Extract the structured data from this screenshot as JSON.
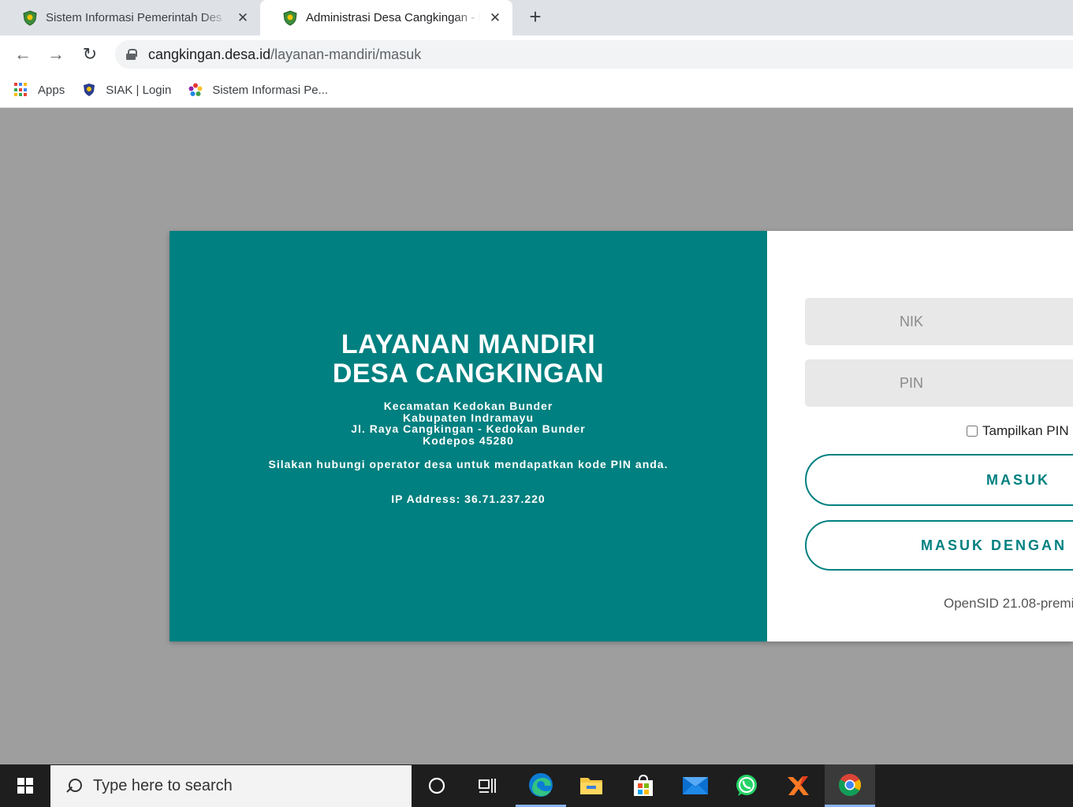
{
  "browser": {
    "tabs": [
      {
        "title": "Sistem Informasi Pemerintah Des",
        "active": false,
        "favicon": "village-emblem-icon"
      },
      {
        "title": "Administrasi Desa Cangkingan - L",
        "active": true,
        "favicon": "village-emblem-icon"
      }
    ],
    "close_glyph": "✕",
    "new_tab_glyph": "+",
    "nav": {
      "back": "←",
      "forward": "→",
      "reload": "↻"
    },
    "url_host": "cangkingan.desa.id",
    "url_path": "/layanan-mandiri/masuk",
    "bookmarks": [
      {
        "label": "Apps",
        "icon": "apps-grid-icon"
      },
      {
        "label": "SIAK | Login",
        "icon": "emblem-icon"
      },
      {
        "label": "Sistem Informasi Pe...",
        "icon": "colorful-flower-icon"
      }
    ]
  },
  "login": {
    "heading_line1": "LAYANAN MANDIRI",
    "heading_line2": "DESA CANGKINGAN",
    "address_lines": [
      "Kecamatan Kedokan Bunder",
      "Kabupaten Indramayu",
      "Jl. Raya Cangkingan - Kedokan Bunder",
      "Kodepos 45280"
    ],
    "note": "Silakan hubungi operator desa untuk mendapatkan kode PIN anda.",
    "ip": "IP Address: 36.71.237.220",
    "nik_placeholder": "NIK",
    "pin_placeholder": "PIN",
    "show_pin_label": "Tampilkan PIN",
    "masuk_label": "MASUK",
    "ektp_label": "MASUK DENGAN E",
    "version": "OpenSID 21.08-premi",
    "colors": {
      "teal": "#008080"
    }
  },
  "taskbar": {
    "search_placeholder": "Type here to search"
  }
}
